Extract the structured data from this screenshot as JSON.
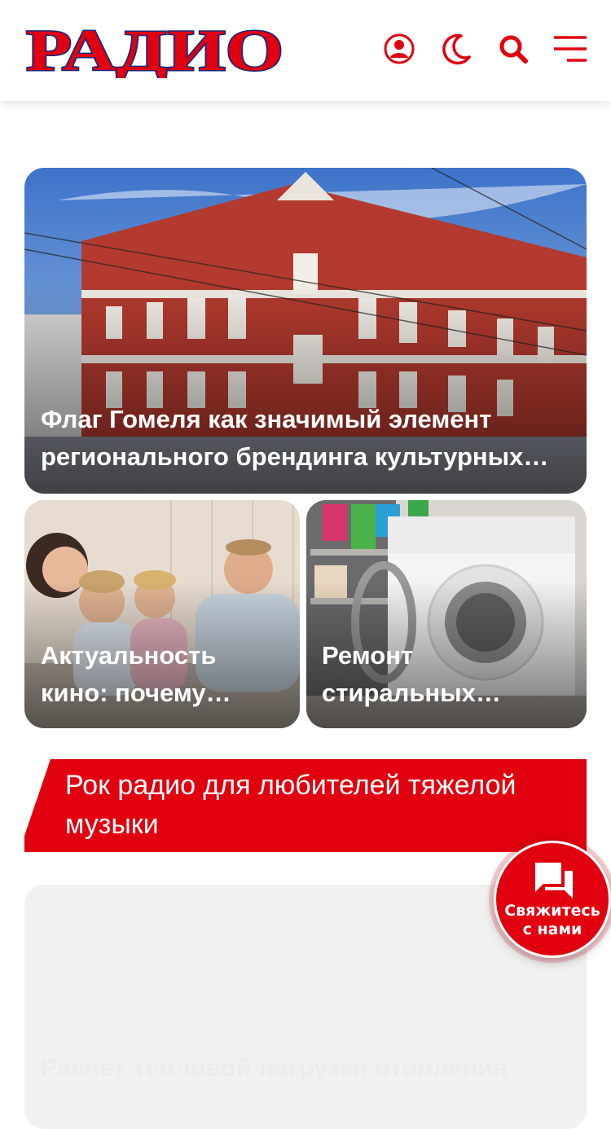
{
  "header": {
    "logo_text": "РАДИО",
    "icons": [
      "user-icon",
      "moon-icon",
      "search-icon",
      "menu-icon"
    ]
  },
  "featured": {
    "title": "Флаг Гомеля как значимый элемент регионального брендинга культурных…"
  },
  "cards": [
    {
      "title_line1": "Актуальность",
      "title_line2": "кино: почему…"
    },
    {
      "title_line1": "Ремонт",
      "title_line2": "стиральных…"
    }
  ],
  "section": {
    "title": "Рок радио для любителей тяжелой музыки"
  },
  "next_article": {
    "title": "Расчёт тепловой нагрузки отопления"
  },
  "contact": {
    "line1": "Свяжитесь",
    "line2": "с нами"
  },
  "colors": {
    "accent": "#e0000f",
    "logo_outline": "#1c2a7a"
  }
}
